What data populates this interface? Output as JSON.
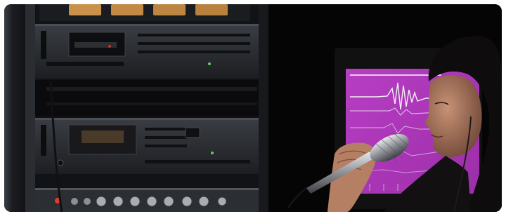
{
  "scene": {
    "kind": "photo",
    "description_icon": "photo-icon",
    "colors": {
      "background": "#060606",
      "rack_metal": "#2b2e33",
      "rack_dark": "#141518",
      "screen_magenta": "#c03cc8",
      "screen_trace": "#f2f2f2",
      "vu_amber": "#c9914a",
      "led_green": "#58d05a",
      "led_red": "#e23a2b",
      "skin": "#b57f64",
      "hair": "#0e0c0c",
      "mic_silver": "#b9bcc1"
    }
  }
}
